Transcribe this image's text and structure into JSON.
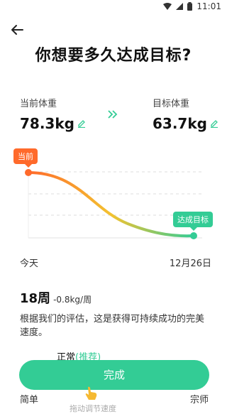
{
  "status_bar": {
    "time": "11:01"
  },
  "title": "你想要多久达成目标?",
  "current": {
    "label": "当前体重",
    "value": "78.3kg"
  },
  "target": {
    "label": "目标体重",
    "value": "63.7kg"
  },
  "chart": {
    "start_tag": "当前",
    "end_tag": "达成目标",
    "x_start": "今天",
    "x_end": "12月26日",
    "colors": {
      "start": "#ff6a2b",
      "mid": "#f3c230",
      "end": "#33cc95"
    }
  },
  "duration": {
    "weeks": "18周",
    "rate": "-0.8kg/周"
  },
  "description": "根据我们的评估，这是获得可持续成功的完美速度。",
  "pace": {
    "normal": "正常",
    "recommended": "(推荐)",
    "left": "简单",
    "right": "宗师"
  },
  "done_button": "完成",
  "hint": "拖动调节速度"
}
